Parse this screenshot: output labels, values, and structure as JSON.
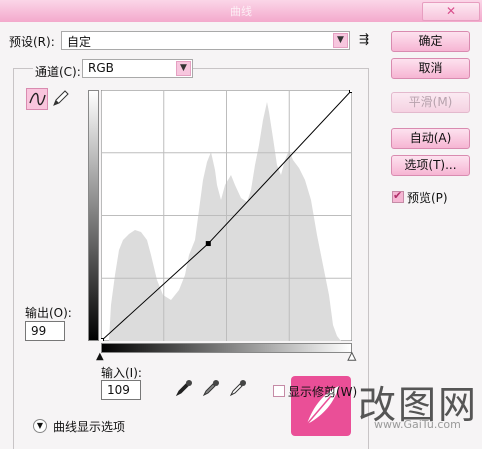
{
  "window": {
    "title": "曲线",
    "close_symbol": "✕"
  },
  "preset": {
    "label": "预设(R):",
    "value": "自定",
    "menu_icon_glyph": "⇶"
  },
  "channel": {
    "label": "通道(C):",
    "value": "RGB"
  },
  "buttons": {
    "ok": "确定",
    "cancel": "取消",
    "smooth": "平滑(M)",
    "auto": "自动(A)",
    "options": "选项(T)..."
  },
  "preview": {
    "label": "预览(P)",
    "checked": true
  },
  "output": {
    "label": "输出(O):",
    "value": "99"
  },
  "input": {
    "label": "输入(I):",
    "value": "109"
  },
  "show_clipping": {
    "label": "显示修剪(W)",
    "checked": false
  },
  "curve_options": {
    "label": "曲线显示选项"
  },
  "curve": {
    "control_point": {
      "input": 109,
      "output": 99
    }
  },
  "watermark": {
    "text": "改图网",
    "url": "www.GaiTu.com"
  },
  "colors": {
    "accent": "#f6b5d3",
    "histogram": "#dcdcdc",
    "logo": "#ea4f97"
  }
}
